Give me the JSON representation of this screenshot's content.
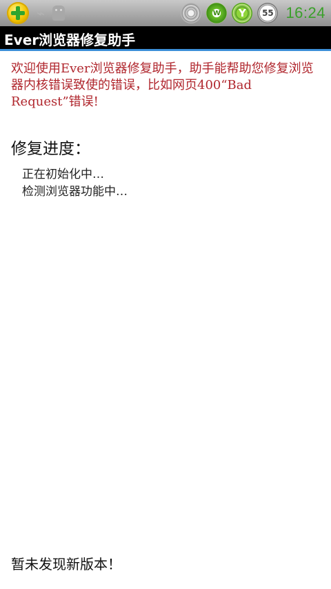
{
  "statusbar": {
    "left_icons": [
      "360-security-icon",
      "usb-icon",
      "android-debug-icon"
    ],
    "right_icons": [
      "wifi-signal-icon",
      "w-app-icon",
      "y-app-icon",
      "battery-icon"
    ],
    "w_icon_label": "W",
    "y_icon_label": "Y",
    "battery_level": "55",
    "time": "16:24",
    "time_color": "#3aa02a"
  },
  "app": {
    "title": "Ever浏览器修复助手"
  },
  "intro": {
    "text": "欢迎使用Ever浏览器修复助手，助手能帮助您修复浏览器内核错误致使的错误，比如网页400“Bad Request”错误!",
    "color": "#b0262d"
  },
  "progress": {
    "heading": "修复进度：",
    "steps": [
      "正在初始化中…",
      "检测浏览器功能中…"
    ]
  },
  "footer": {
    "message": "暂未发现新版本！"
  }
}
